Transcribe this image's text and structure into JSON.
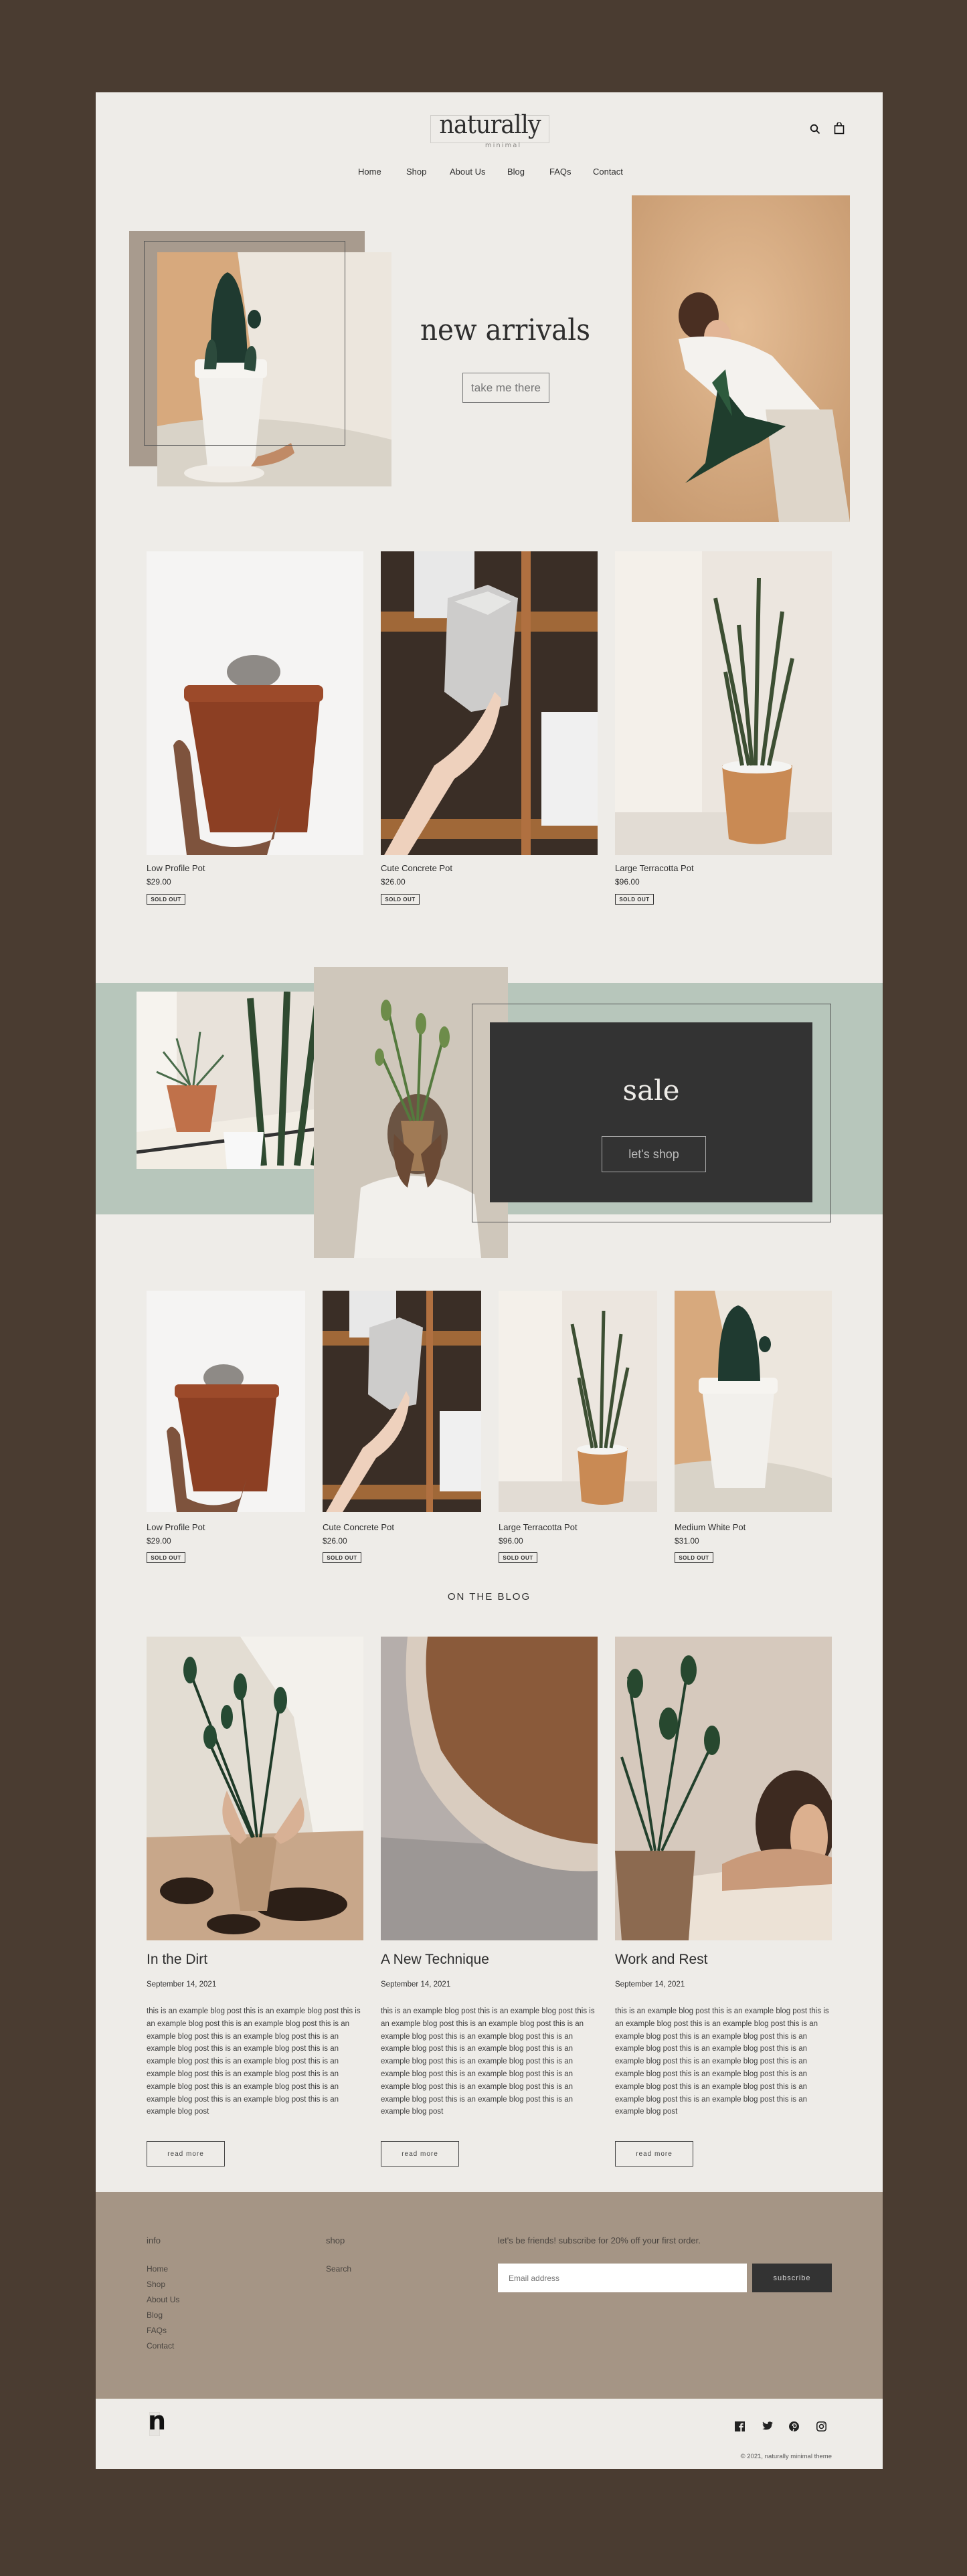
{
  "header": {
    "logo_main": "naturally",
    "logo_sub": "minimal",
    "icons": [
      "search-icon",
      "shopping-bag-icon"
    ]
  },
  "nav": [
    {
      "label": "Home"
    },
    {
      "label": "Shop"
    },
    {
      "label": "About Us"
    },
    {
      "label": "Blog"
    },
    {
      "label": "FAQs"
    },
    {
      "label": "Contact"
    }
  ],
  "hero": {
    "title": "new arrivals",
    "cta": "take me there"
  },
  "featured_products": [
    {
      "name": "Low Profile Pot",
      "price": "$29.00",
      "badge": "SOLD OUT"
    },
    {
      "name": "Cute Concrete Pot",
      "price": "$26.00",
      "badge": "SOLD OUT"
    },
    {
      "name": "Large Terracotta Pot",
      "price": "$96.00",
      "badge": "SOLD OUT"
    }
  ],
  "sale": {
    "title": "sale",
    "cta": "let's shop"
  },
  "products": [
    {
      "name": "Low Profile Pot",
      "price": "$29.00",
      "badge": "SOLD OUT"
    },
    {
      "name": "Cute Concrete Pot",
      "price": "$26.00",
      "badge": "SOLD OUT"
    },
    {
      "name": "Large Terracotta Pot",
      "price": "$96.00",
      "badge": "SOLD OUT"
    },
    {
      "name": "Medium White Pot",
      "price": "$31.00",
      "badge": "SOLD OUT"
    }
  ],
  "blog": {
    "heading": "ON THE BLOG",
    "posts": [
      {
        "title": "In the Dirt",
        "date": "September 14, 2021",
        "excerpt": "this is an example blog post this is an example blog post this is an example blog post this is an example blog post this is an example blog post this is an example blog post this is an example blog post this is an example blog post this is an example blog post this is an example blog post this is an example blog post this is an example blog post this is an example blog post this is an example blog post this is an example blog post this is an example blog post this is an example blog post",
        "button": "read more"
      },
      {
        "title": "A New Technique",
        "date": "September 14, 2021",
        "excerpt": "this is an example blog post this is an example blog post this is an example blog post this is an example blog post this is an example blog post this is an example blog post this is an example blog post this is an example blog post this is an example blog post this is an example blog post this is an example blog post this is an example blog post this is an example blog post this is an example blog post this is an example blog post this is an example blog post this is an example blog post",
        "button": "read more"
      },
      {
        "title": "Work and Rest",
        "date": "September 14, 2021",
        "excerpt": "this is an example blog post this is an example blog post this is an example blog post this is an example blog post this is an example blog post this is an example blog post this is an example blog post this is an example blog post this is an example blog post this is an example blog post this is an example blog post this is an example blog post this is an example blog post this is an example blog post this is an example blog post this is an example blog post this is an example blog post",
        "button": "read more"
      }
    ]
  },
  "footer": {
    "info_heading": "info",
    "info_links": [
      "Home",
      "Shop",
      "About Us",
      "Blog",
      "FAQs",
      "Contact"
    ],
    "shop_heading": "shop",
    "shop_links": [
      "Search"
    ],
    "newsletter_text": "let's be friends! subscribe for 20% off your first order.",
    "email_placeholder": "Email address",
    "subscribe_label": "subscribe",
    "mini_logo": "n",
    "social": [
      "facebook-icon",
      "twitter-icon",
      "pinterest-icon",
      "instagram-icon"
    ],
    "copyright": "© 2021, naturally minimal theme"
  },
  "colors": {
    "page_bg": "#4a3c31",
    "card_bg": "#eeece8",
    "sage": "#b7c6bb",
    "taupe": "#a59585",
    "dark": "#333333"
  }
}
